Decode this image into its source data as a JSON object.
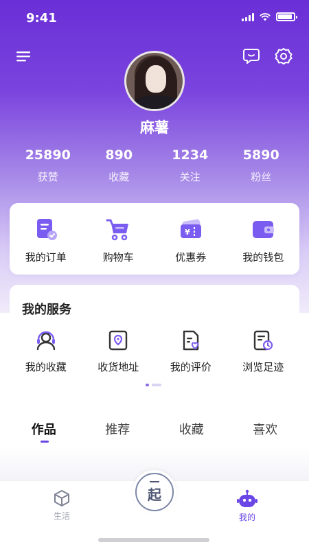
{
  "status_bar": {
    "time": "9:41"
  },
  "profile": {
    "username": "麻薯"
  },
  "stats": [
    {
      "value": "25890",
      "label": "获赞"
    },
    {
      "value": "890",
      "label": "收藏"
    },
    {
      "value": "1234",
      "label": "关注"
    },
    {
      "value": "5890",
      "label": "粉丝"
    }
  ],
  "quick_actions": [
    {
      "label": "我的订单",
      "icon": "order-icon"
    },
    {
      "label": "购物车",
      "icon": "cart-icon"
    },
    {
      "label": "优惠券",
      "icon": "coupon-icon"
    },
    {
      "label": "我的钱包",
      "icon": "wallet-icon"
    }
  ],
  "services": {
    "title": "我的服务",
    "items": [
      {
        "label": "我的收藏",
        "icon": "favorites-icon"
      },
      {
        "label": "收货地址",
        "icon": "address-icon"
      },
      {
        "label": "我的评价",
        "icon": "review-icon"
      },
      {
        "label": "浏览足迹",
        "icon": "history-icon"
      }
    ]
  },
  "tabs": [
    {
      "label": "作品",
      "active": true
    },
    {
      "label": "推荐",
      "active": false
    },
    {
      "label": "收藏",
      "active": false
    },
    {
      "label": "喜欢",
      "active": false
    }
  ],
  "bottom_nav": {
    "life_label": "生活",
    "center_label": "起",
    "mine_label": "我的"
  },
  "colors": {
    "accent": "#6a46e6",
    "header_gradient_top": "#6a2fd6",
    "icon_purple": "#7b5cf0"
  }
}
